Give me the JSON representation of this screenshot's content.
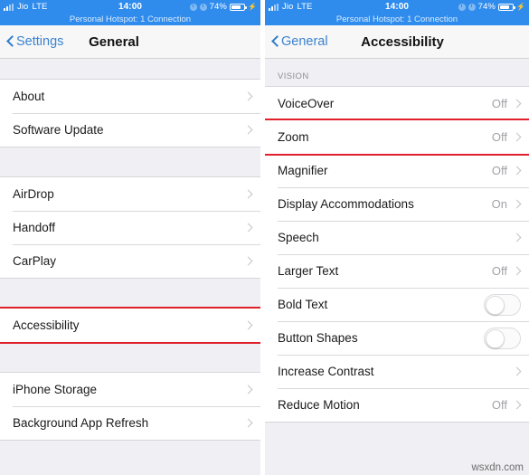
{
  "status_bar": {
    "signal_icon": "signal-bars-icon",
    "carrier": "Jio",
    "network": "LTE",
    "time": "14:00",
    "location_icon": "location-arrow-icon",
    "alarm_icon": "alarm-clock-icon",
    "battery_percent": "74%",
    "battery_icon": "battery-icon",
    "charging_icon": "lightning-bolt-icon",
    "hotspot_text": "Personal Hotspot: 1 Connection"
  },
  "colors": {
    "status_bar_bg": "#2f8ced",
    "accent_blue": "#3b83ce",
    "highlight_red": "#e0202a",
    "list_bg": "#ffffff",
    "page_bg": "#efeff4",
    "value_gray": "#a2a2a8"
  },
  "left_panel": {
    "nav": {
      "back_label": "Settings",
      "back_icon": "chevron-left-icon",
      "title": "General"
    },
    "groups": [
      {
        "label": "",
        "rows": [
          {
            "label": "About",
            "value": "",
            "accessory": "chevron",
            "highlighted": false
          },
          {
            "label": "Software Update",
            "value": "",
            "accessory": "chevron",
            "highlighted": false
          }
        ]
      },
      {
        "label": "",
        "rows": [
          {
            "label": "AirDrop",
            "value": "",
            "accessory": "chevron",
            "highlighted": false
          },
          {
            "label": "Handoff",
            "value": "",
            "accessory": "chevron",
            "highlighted": false
          },
          {
            "label": "CarPlay",
            "value": "",
            "accessory": "chevron",
            "highlighted": false
          }
        ]
      },
      {
        "label": "",
        "rows": [
          {
            "label": "Accessibility",
            "value": "",
            "accessory": "chevron",
            "highlighted": true
          }
        ]
      },
      {
        "label": "",
        "rows": [
          {
            "label": "iPhone Storage",
            "value": "",
            "accessory": "chevron",
            "highlighted": false
          },
          {
            "label": "Background App Refresh",
            "value": "",
            "accessory": "chevron",
            "highlighted": false
          }
        ]
      }
    ]
  },
  "right_panel": {
    "nav": {
      "back_label": "General",
      "back_icon": "chevron-left-icon",
      "title": "Accessibility"
    },
    "groups": [
      {
        "label": "VISION",
        "rows": [
          {
            "label": "VoiceOver",
            "value": "Off",
            "accessory": "chevron",
            "highlighted": false
          },
          {
            "label": "Zoom",
            "value": "Off",
            "accessory": "chevron",
            "highlighted": true
          },
          {
            "label": "Magnifier",
            "value": "Off",
            "accessory": "chevron",
            "highlighted": false
          },
          {
            "label": "Display Accommodations",
            "value": "On",
            "accessory": "chevron",
            "highlighted": false
          },
          {
            "label": "Speech",
            "value": "",
            "accessory": "chevron",
            "highlighted": false
          },
          {
            "label": "Larger Text",
            "value": "Off",
            "accessory": "chevron",
            "highlighted": false
          },
          {
            "label": "Bold Text",
            "value": "",
            "accessory": "toggle",
            "toggle_on": false,
            "highlighted": false
          },
          {
            "label": "Button Shapes",
            "value": "",
            "accessory": "toggle",
            "toggle_on": false,
            "highlighted": false
          },
          {
            "label": "Increase Contrast",
            "value": "",
            "accessory": "chevron",
            "highlighted": false
          },
          {
            "label": "Reduce Motion",
            "value": "Off",
            "accessory": "chevron",
            "highlighted": false
          }
        ]
      }
    ]
  },
  "watermark": "wsxdn.com"
}
